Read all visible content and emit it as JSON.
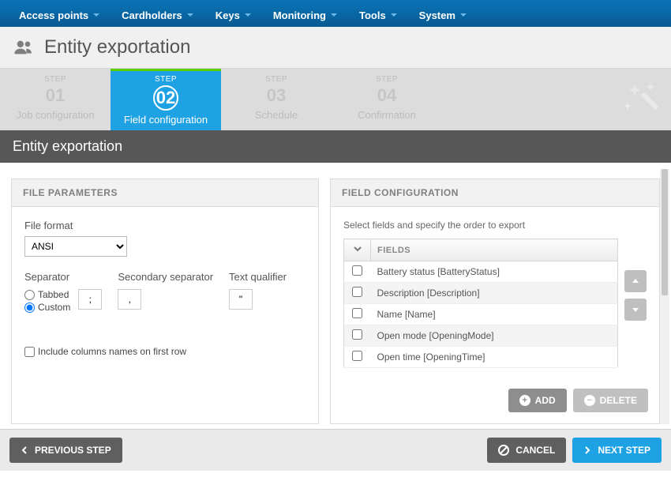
{
  "topnav": [
    "Access points",
    "Cardholders",
    "Keys",
    "Monitoring",
    "Tools",
    "System"
  ],
  "page_title": "Entity exportation",
  "wizard": {
    "step_label": "STEP",
    "steps": [
      {
        "num": "01",
        "name": "Job configuration"
      },
      {
        "num": "02",
        "name": "Field configuration"
      },
      {
        "num": "03",
        "name": "Schedule"
      },
      {
        "num": "04",
        "name": "Confirmation"
      }
    ],
    "active_index": 1
  },
  "section_header": "Entity exportation",
  "file_params": {
    "panel_title": "FILE PARAMETERS",
    "file_format_label": "File format",
    "file_format_value": "ANSI",
    "separator_label": "Separator",
    "separator_options": {
      "tabbed": "Tabbed",
      "custom": "Custom"
    },
    "separator_selected": "custom",
    "separator_value": ";",
    "secondary_separator_label": "Secondary separator",
    "secondary_separator_value": ",",
    "text_qualifier_label": "Text qualifier",
    "text_qualifier_value": "\"",
    "include_columns_label": "Include columns names on first row",
    "include_columns_checked": false
  },
  "field_config": {
    "panel_title": "FIELD CONFIGURATION",
    "hint": "Select fields and specify the order to export",
    "header_fields": "FIELDS",
    "rows": [
      "Battery status [BatteryStatus]",
      "Description [Description]",
      "Name [Name]",
      "Open mode [OpeningMode]",
      "Open time [OpeningTime]"
    ],
    "add_label": "ADD",
    "delete_label": "DELETE"
  },
  "footer": {
    "prev": "PREVIOUS STEP",
    "cancel": "CANCEL",
    "next": "NEXT STEP"
  }
}
